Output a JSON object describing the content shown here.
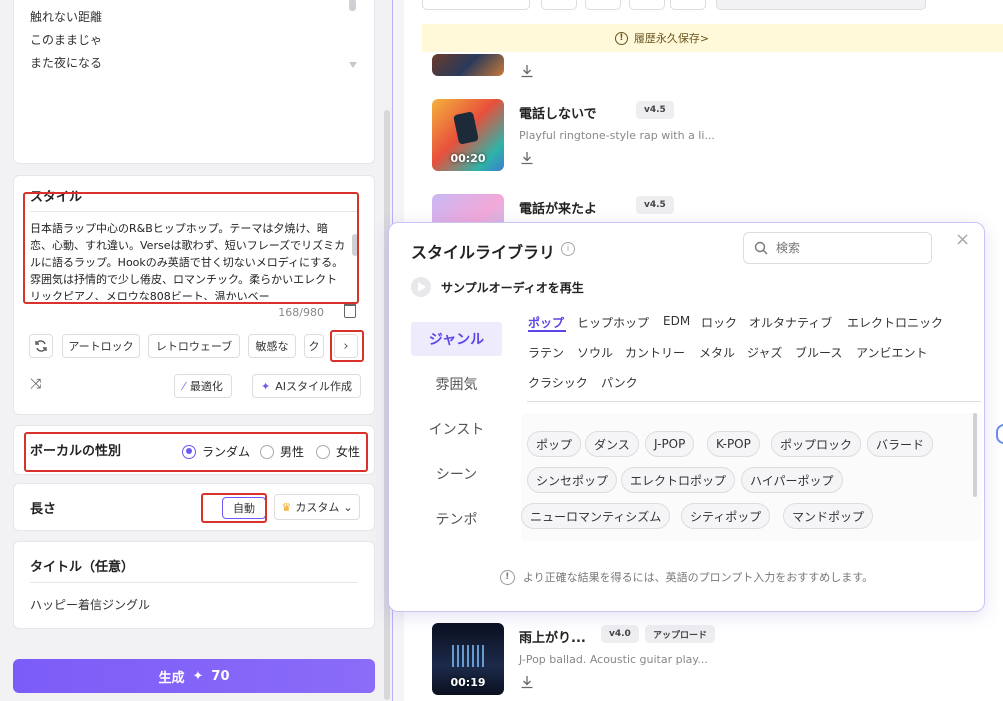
{
  "lyrics": {
    "lines": [
      "触れない距離",
      "このままじゃ",
      "また夜になる"
    ]
  },
  "style_card": {
    "title": "スタイル",
    "text": "日本語ラップ中心のR&Bヒップホップ。テーマは夕焼け、暗恋、心動、すれ違い。Verseは歌わず、短いフレーズでリズミカルに語るラップ。Hookのみ英語で甘く切ないメロディにする。雰囲気は抒情的で少し倦皮、ロマンチック。柔らかいエレクトリックピアノ、メロウな808ビート、温かいベー",
    "counter": "168/980",
    "chips": [
      "アートロック",
      "レトロウェーブ",
      "敏感な",
      "ク"
    ],
    "optimize_label": "最適化",
    "ai_style_label": "AIスタイル作成"
  },
  "vocal": {
    "title": "ボーカルの性別",
    "options": [
      "ランダム",
      "男性",
      "女性"
    ],
    "selected": "ランダム"
  },
  "length": {
    "title": "長さ",
    "auto_label": "自動",
    "custom_label": "カスタム"
  },
  "title_card": {
    "title": "タイトル（任意）",
    "value": "ハッピー着信ジングル"
  },
  "generate": {
    "label": "生成",
    "cost": "70"
  },
  "banner": {
    "text": "履歴永久保存>"
  },
  "songs": [
    {
      "title": "電話しないで",
      "version": "v4.5",
      "desc": "Playful ringtone-style rap with a li...",
      "duration": "00:20"
    },
    {
      "title": "電話が来たよ",
      "version": "v4.5",
      "desc": "",
      "duration": ""
    },
    {
      "title": "雨上がり...",
      "version": "v4.0",
      "tag": "アップロード",
      "desc": "J-Pop ballad. Acoustic guitar play...",
      "duration": "00:19"
    }
  ],
  "popup": {
    "title": "スタイルライブラリ",
    "search_placeholder": "検索",
    "play_label": "サンプルオーディオを再生",
    "categories": [
      "ジャンル",
      "雰囲気",
      "インスト",
      "シーン",
      "テンポ"
    ],
    "genre_tabs": [
      "ポップ",
      "ヒップホップ",
      "EDM",
      "ロック",
      "オルタナティブ",
      "エレクトロニック",
      "ラテン",
      "ソウル",
      "カントリー",
      "メタル",
      "ジャズ",
      "ブルース",
      "アンビエント",
      "クラシック",
      "パンク"
    ],
    "tags": [
      "ポップ",
      "ダンス",
      "J-POP",
      "K-POP",
      "ポップロック",
      "バラード",
      "シンセポップ",
      "エレクトロポップ",
      "ハイパーポップ",
      "ニューロマンティシズム",
      "シティポップ",
      "マンドポップ"
    ],
    "hint": "より正確な結果を得るには、英語のプロンプト入力をおすすめします。"
  },
  "colors": {
    "accent": "#6b5bf2",
    "generate_button": "#7c5cf7",
    "highlight_box": "#d8322a",
    "banner_bg": "#fff8d9"
  }
}
